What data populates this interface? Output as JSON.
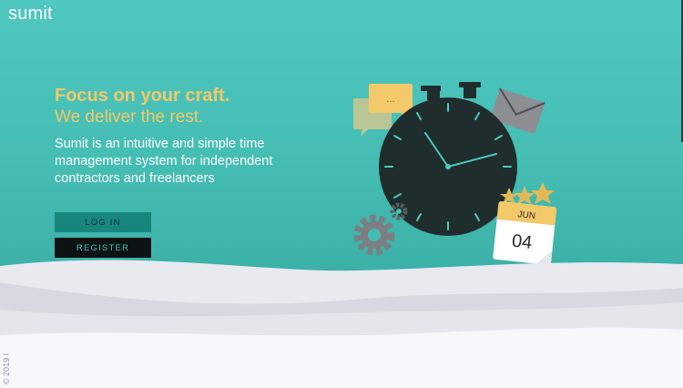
{
  "header": {
    "brand": "sumit"
  },
  "hero": {
    "headline": "Focus on your craft.",
    "subheadline": "We deliver the rest.",
    "description": "Sumit is an intuitive and simple time management system for independent contractors and freelancers",
    "login_label": "LOG IN",
    "register_label": "REGISTER"
  },
  "illustration": {
    "chat_bubble_text": "...",
    "calendar_month": "JUN",
    "calendar_day": "04",
    "stars_rating": 3,
    "icons": [
      "stopwatch-icon",
      "chat-bubble-icon",
      "envelope-icon",
      "gear-icon",
      "calendar-icon",
      "star-icon"
    ]
  },
  "footer": {
    "copyright": "© 2019 I"
  },
  "colors": {
    "background": "#4ac4bc",
    "accent_yellow": "#f3c969",
    "login_button": "#17877d",
    "register_button": "#0d1212",
    "stopwatch": "#1f2d2d"
  }
}
